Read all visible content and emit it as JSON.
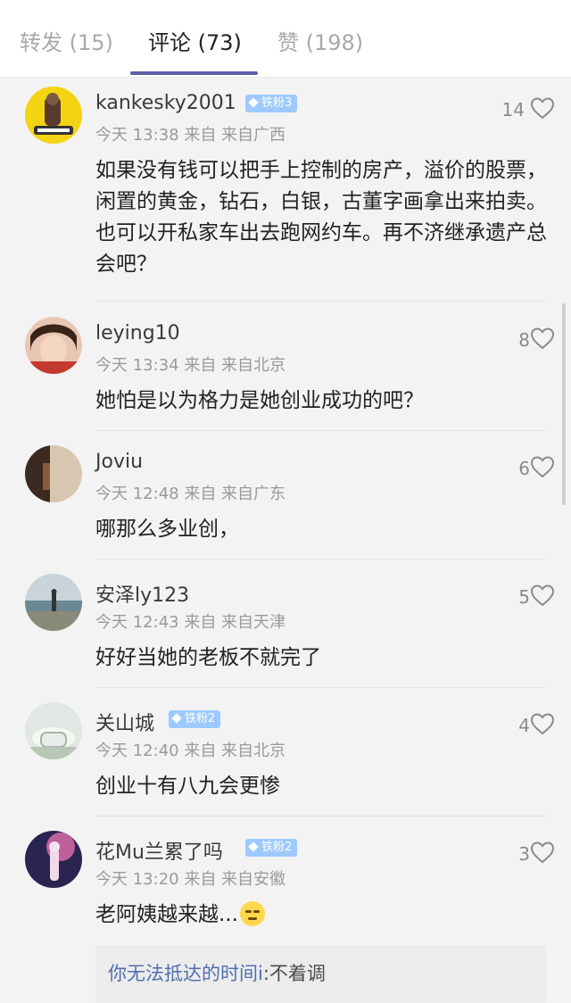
{
  "tabs": [
    {
      "label": "转发 (15)"
    },
    {
      "label": "评论 (73)"
    },
    {
      "label": "赞 (198)"
    }
  ],
  "comments": [
    {
      "user": "kankesky2001",
      "badge": "铁粉3",
      "time": "今天 13:38 来自 来自广西",
      "likes": "14",
      "text": "如果没有钱可以把手上控制的房产，溢价的股票，闲置的黄金，钻石，白银，古董字画拿出来拍卖。也可以开私家车出去跑网约车。再不济继承遗产总会吧？"
    },
    {
      "user": "leying10",
      "badge": "",
      "time": "今天 13:34 来自 来自北京",
      "likes": "8",
      "text": "她怕是以为格力是她创业成功的吧？"
    },
    {
      "user": "Joviu",
      "badge": "",
      "time": "今天 12:48 来自 来自广东",
      "likes": "6",
      "text": "哪那么多业创，"
    },
    {
      "user": "安泽ly123",
      "badge": "",
      "time": "今天 12:43 来自 来自天津",
      "likes": "5",
      "text": "好好当她的老板不就完了"
    },
    {
      "user": "关山城",
      "badge": "铁粉2",
      "time": "今天 12:40 来自 来自北京",
      "likes": "4",
      "text": "创业十有八九会更惨"
    },
    {
      "user": "花Mu兰累了吗",
      "badge": "铁粉2",
      "time": "今天 13:20 来自 来自安徽",
      "likes": "3",
      "text": "老阿姨越来越..."
    }
  ],
  "reply": {
    "user": "你无法抵达的时间i",
    "text": ":不着调"
  },
  "colors": {
    "accent": "#5b5fa8",
    "badge": "#9ec9ff",
    "reply_user": "#4f6fae"
  }
}
